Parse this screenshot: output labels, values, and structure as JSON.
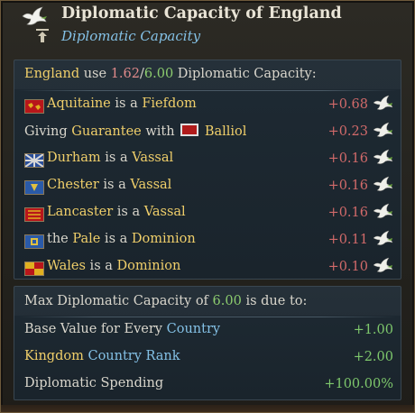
{
  "header": {
    "title": "Diplomatic Capacity of England",
    "subtitle": "Diplomatic Capacity",
    "icon": "dove-icon",
    "secondary_icon": "arrow-up-icon"
  },
  "usage": {
    "country": "England",
    "use_text": "use",
    "used": "1.62",
    "separator": "/",
    "total": "6.00",
    "suffix": "Diplomatic Capacity:"
  },
  "relations": [
    {
      "name": "Aquitaine",
      "pre": "",
      "mid": " is a ",
      "type": "Fiefdom",
      "value": "+0.68",
      "flag_colors": [
        "#b8161a",
        "#e0b020"
      ]
    },
    {
      "name": "Balliol",
      "pre": "Giving ",
      "mid": "Guarantee",
      "post_mid": " with ",
      "type": "",
      "value": "+0.23",
      "flag_colors": [
        "#b01b1b",
        "#e0e0e0"
      ]
    },
    {
      "name": "Durham",
      "pre": "",
      "mid": " is a ",
      "type": "Vassal",
      "value": "+0.16",
      "flag_colors": [
        "#2a4f9a",
        "#d8d8d8"
      ]
    },
    {
      "name": "Chester",
      "pre": "",
      "mid": " is a ",
      "type": "Vassal",
      "value": "+0.16",
      "flag_colors": [
        "#2a5aa8",
        "#e0c040"
      ]
    },
    {
      "name": "Lancaster",
      "pre": "",
      "mid": " is a ",
      "type": "Vassal",
      "value": "+0.16",
      "flag_colors": [
        "#b8161a",
        "#e0b020"
      ]
    },
    {
      "name": "the Pale",
      "pre": "",
      "mid": " is a ",
      "type": "Dominion",
      "value": "+0.11",
      "flag_colors": [
        "#2a5aa8",
        "#e0c040"
      ]
    },
    {
      "name": "Wales",
      "pre": "",
      "mid": " is a ",
      "type": "Dominion",
      "value": "+0.10",
      "flag_colors": [
        "#b8161a",
        "#e0b020"
      ]
    }
  ],
  "max": {
    "prefix": "Max Diplomatic Capacity of ",
    "value": "6.00",
    "suffix": " is due to:",
    "items": [
      {
        "label_a": "Base Value for Every ",
        "label_b": "Country",
        "value": "+1.00"
      },
      {
        "label_a": "Kingdom",
        "label_b": "Country Rank",
        "value": "+2.00"
      },
      {
        "label_a": "Diplomatic Spending",
        "label_b": "",
        "value": "+100.00%"
      }
    ]
  }
}
